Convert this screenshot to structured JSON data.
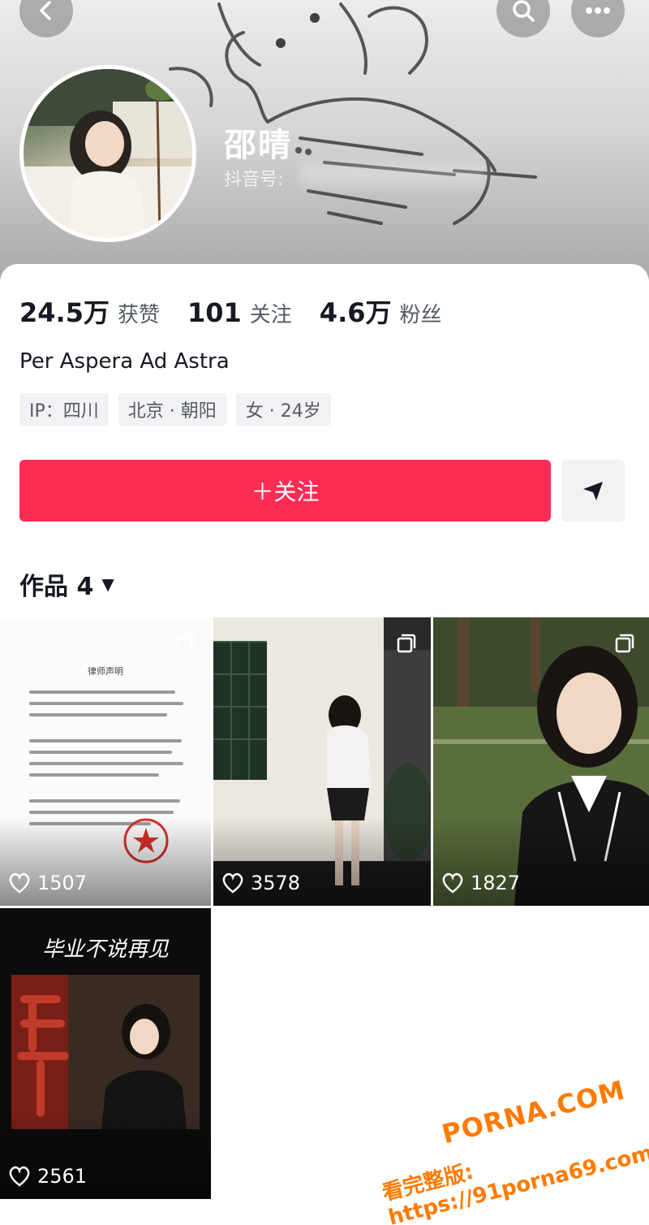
{
  "header": {
    "display_name": "邵晴",
    "douyin_id_label": "抖音号:"
  },
  "stats": [
    {
      "value": "24.5万",
      "label": "获赞"
    },
    {
      "value": "101",
      "label": "关注"
    },
    {
      "value": "4.6万",
      "label": "粉丝"
    }
  ],
  "bio": "Per Aspera Ad Astra",
  "tags": [
    "IP：四川",
    "北京 · 朝阳",
    "女 · 24岁"
  ],
  "follow_button": "＋关注",
  "works": {
    "label": "作品 4",
    "caret": "▼",
    "items": [
      {
        "likes": "1507",
        "doc_title": "律师声明"
      },
      {
        "likes": "3578"
      },
      {
        "likes": "1827"
      },
      {
        "likes": "2561",
        "poster_text": "毕业不说再见"
      }
    ]
  },
  "watermark": {
    "brand": "PORNA.COM",
    "sub": "看完整版: https://91porna69.com"
  },
  "colors": {
    "accent": "#fe2c55",
    "watermark": "#ff7a00"
  }
}
